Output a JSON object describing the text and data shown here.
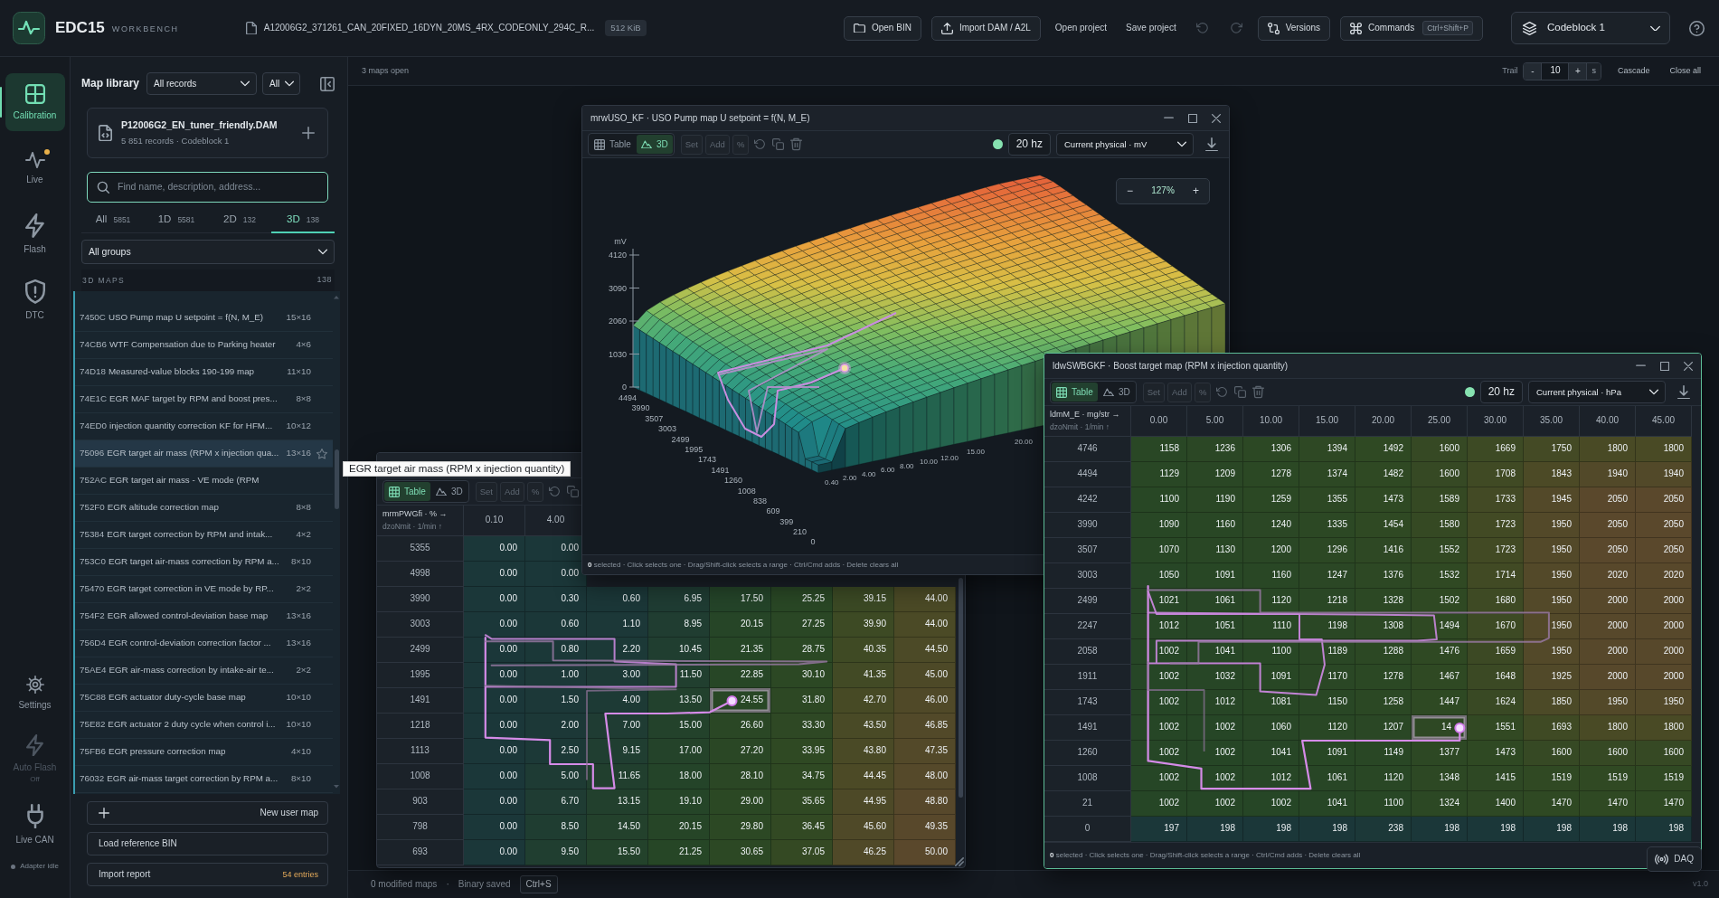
{
  "header": {
    "app_name": "EDC15",
    "tagline": "WORKBENCH",
    "file_name": "A12006G2_371261_CAN_20FIXED_16DYN_20MS_4RX_CODEONLY_294C_R...",
    "file_size": "512 KiB",
    "actions": [
      {
        "kind": "button",
        "label": "Open BIN"
      },
      {
        "kind": "button",
        "label": "Import DAM / A2L"
      },
      {
        "kind": "link",
        "label": "Open project"
      },
      {
        "kind": "link",
        "label": "Save project"
      },
      {
        "kind": "icon",
        "disabled": true
      },
      {
        "kind": "icon",
        "disabled": true
      },
      {
        "kind": "button",
        "label": "Versions"
      },
      {
        "kind": "button",
        "label": "Commands",
        "shortcut": "Ctrl+Shift+P"
      }
    ],
    "codeblock": "Codeblock 1"
  },
  "rail": {
    "items": [
      {
        "label": "Calibration",
        "selected": true,
        "alert": false
      },
      {
        "label": "Live",
        "selected": false,
        "alert": true
      },
      {
        "label": "Flash",
        "selected": false,
        "alert": false
      },
      {
        "label": "DTC",
        "selected": false,
        "alert": false
      }
    ],
    "tools": [
      {
        "label": "Settings",
        "disabled": false
      },
      {
        "label": "Auto Flash",
        "status": "Off",
        "disabled": true
      },
      {
        "label": "Live CAN",
        "disabled": false
      }
    ],
    "adapter": {
      "label": "Adapter idle",
      "connected": false
    }
  },
  "library": {
    "title": "Map library",
    "record_filter": "All records",
    "scope_filter": "All",
    "source": {
      "name": "P12006G2_EN_tuner_friendly.DAM",
      "info": "5 851 records · Codeblock 1"
    },
    "search": {
      "placeholder": "Find name, description, address...",
      "focused": true
    },
    "tabs": [
      {
        "label": "All",
        "count": "5851",
        "selected": false
      },
      {
        "label": "1D",
        "count": "5581",
        "selected": false
      },
      {
        "label": "2D",
        "count": "132",
        "selected": false
      },
      {
        "label": "3D",
        "count": "138",
        "selected": true
      }
    ],
    "group_filter": "All groups",
    "section": {
      "label": "3D MAPS",
      "count": "138"
    },
    "maps": [
      {
        "address": "7450C",
        "name": "USO Pump map U setpoint = f(N, M_E)",
        "size": "15×16",
        "hovered": false
      },
      {
        "address": "74CB6",
        "name": "WTF Compensation due to Parking heater",
        "size": "4×6",
        "hovered": false
      },
      {
        "address": "74D18",
        "name": "Measured-value blocks 190-199 map",
        "size": "11×10",
        "hovered": false
      },
      {
        "address": "74E1C",
        "name": "EGR MAF target by RPM and boost pres...",
        "size": "8×8",
        "hovered": false
      },
      {
        "address": "74ED0",
        "name": "injection quantity correction KF for HFM...",
        "size": "10×12",
        "hovered": false
      },
      {
        "address": "75096",
        "name": "EGR target air mass (RPM x injection qua...",
        "size": "13×16",
        "hovered": true
      },
      {
        "address": "752AC",
        "name": "EGR target air mass - VE mode (RPM",
        "hovered": false
      },
      {
        "address": "752F0",
        "name": "EGR altitude correction map",
        "size": "8×8",
        "hovered": false
      },
      {
        "address": "75384",
        "name": "EGR target correction by RPM and intak...",
        "size": "4×2",
        "hovered": false
      },
      {
        "address": "753C0",
        "name": "EGR target air-mass correction by RPM a...",
        "size": "8×10",
        "hovered": false
      },
      {
        "address": "75470",
        "name": "EGR target correction in VE mode by RP...",
        "size": "2×2",
        "hovered": false
      },
      {
        "address": "754F2",
        "name": "EGR allowed control-deviation base map",
        "size": "13×16",
        "hovered": false
      },
      {
        "address": "756D4",
        "name": "EGR control-deviation correction factor ...",
        "size": "13×16",
        "hovered": false
      },
      {
        "address": "75AE4",
        "name": "EGR air-mass correction by intake-air te...",
        "size": "2×2",
        "hovered": false
      },
      {
        "address": "75C88",
        "name": "EGR actuator duty-cycle base map",
        "size": "10×10",
        "hovered": false
      },
      {
        "address": "75E82",
        "name": "EGR actuator 2 duty cycle when control i...",
        "size": "10×10",
        "hovered": false
      },
      {
        "address": "75FB6",
        "name": "EGR pressure correction map",
        "size": "4×10",
        "hovered": false
      },
      {
        "address": "76032",
        "name": "EGR air-mass target correction by RPM a...",
        "size": "8×10",
        "hovered": false
      }
    ],
    "tooltip": "EGR target air mass (RPM x injection quantity)",
    "actions": [
      {
        "kind": "add",
        "label": "New user map"
      },
      {
        "kind": "plain",
        "label": "Load reference BIN"
      },
      {
        "kind": "plain",
        "label": "Import report",
        "note": "54 entries"
      }
    ]
  },
  "workspace": {
    "summary": "3 maps open",
    "trail": {
      "label": "Trail",
      "decrease": "-",
      "value": "10",
      "increase": "+",
      "unit": "s"
    },
    "actions": [
      "Cascade",
      "Close all"
    ],
    "windows": [
      {
        "kind": "table",
        "active": false,
        "view_tabs": [
          {
            "label": "Table",
            "selected": true
          },
          {
            "label": "3D",
            "selected": false
          }
        ],
        "edit": [
          {
            "label": "Set",
            "disabled": true
          },
          {
            "label": "Add",
            "disabled": true
          },
          {
            "label": "%",
            "disabled": true
          }
        ],
        "tools": [
          {
            "kind": "undo"
          },
          {
            "kind": "copy"
          }
        ],
        "table": {
          "x_axis": "mrmPWGfi · % →",
          "y_axis": "dzoNmit · 1/min ↑",
          "columns": [
            "0.10",
            "4.00"
          ],
          "rows": [
            {
              "label": "5355",
              "values": [
                "0.00",
                "0.00"
              ]
            },
            {
              "label": "4998",
              "values": [
                "0.00",
                "0.00"
              ]
            },
            {
              "label": "3990",
              "values": [
                "0.00",
                "0.30",
                "0.60",
                "6.95",
                "17.50",
                "25.25",
                "39.15",
                "44.00"
              ]
            },
            {
              "label": "3003",
              "values": [
                "0.00",
                "0.60",
                "1.10",
                "8.95",
                "20.15",
                "27.25",
                "39.90",
                "44.00"
              ]
            },
            {
              "label": "2499",
              "values": [
                "0.00",
                "0.80",
                "2.20",
                "10.45",
                "21.35",
                "28.75",
                "40.35",
                "44.50"
              ]
            },
            {
              "label": "1995",
              "values": [
                "0.00",
                "1.00",
                "3.00",
                "11.50",
                "22.85",
                "30.10",
                "41.35",
                "45.00"
              ]
            },
            {
              "label": "1491",
              "values": [
                "0.00",
                "1.50",
                "4.00",
                "13.50",
                {
                  "value": "24.55",
                  "live": true
                },
                "31.80",
                "42.70",
                "46.00"
              ]
            },
            {
              "label": "1218",
              "values": [
                "0.00",
                "2.00",
                "7.00",
                "15.00",
                "26.60",
                "33.30",
                "43.50",
                "46.85"
              ]
            },
            {
              "label": "1113",
              "values": [
                "0.00",
                "2.50",
                "9.15",
                "17.00",
                "27.20",
                "33.95",
                "43.80",
                "47.35"
              ]
            },
            {
              "label": "1008",
              "values": [
                "0.00",
                "5.00",
                "11.65",
                "18.00",
                "28.10",
                "34.75",
                "44.45",
                "48.00"
              ]
            },
            {
              "label": "903",
              "values": [
                "0.00",
                "6.70",
                "13.15",
                "19.10",
                "29.00",
                "35.65",
                "44.95",
                "48.80"
              ]
            },
            {
              "label": "798",
              "values": [
                "0.00",
                "8.50",
                "14.50",
                "20.15",
                "29.80",
                "36.45",
                "45.60",
                "49.35"
              ]
            },
            {
              "label": "693",
              "values": [
                "0.00",
                "9.50",
                "15.50",
                "21.25",
                "30.65",
                "37.05",
                "46.25",
                "50.00"
              ]
            }
          ]
        }
      },
      {
        "kind": "surface",
        "title": "mrwUSO_KF · USO Pump map U setpoint = f(N, M_E)",
        "active": false,
        "controls": true,
        "view_tabs": [
          {
            "label": "Table",
            "selected": false
          },
          {
            "label": "3D",
            "selected": true
          }
        ],
        "edit": [
          {
            "label": "Set",
            "disabled": true
          },
          {
            "label": "Add",
            "disabled": true
          },
          {
            "label": "%",
            "disabled": true
          }
        ],
        "tools": [
          {
            "kind": "undo"
          },
          {
            "kind": "copy"
          },
          {
            "kind": "delete"
          }
        ],
        "live": true,
        "rate": "20 hz",
        "source": "Current physical · mV",
        "plot": {
          "z_unit": "mV",
          "z_ticks": [
            "4120",
            "3090",
            "2060",
            "1030",
            "0"
          ],
          "rpm_ticks": [
            "4494",
            "3990",
            "3507",
            "3003",
            "2499",
            "1995",
            "1743",
            "1491",
            "1260",
            "1008",
            "838",
            "609",
            "399",
            "210",
            "0"
          ],
          "injection_ticks": [
            "0.40",
            "2.00",
            "4.00",
            "6.00",
            "8.00",
            "10.00",
            "12.00",
            "15.00",
            "20.00"
          ]
        },
        "zoom": {
          "decrease": "−",
          "level": "127%",
          "increase": "+"
        },
        "footer": "**0** selected · Click selects one · Drag/Shift-click selects a range · Ctrl/Cmd adds · Delete clears all"
      },
      {
        "kind": "table",
        "title": "ldwSWBGKF · Boost target map (RPM x injection quantity)",
        "active": true,
        "controls": true,
        "view_tabs": [
          {
            "label": "Table",
            "selected": true
          },
          {
            "label": "3D",
            "selected": false
          }
        ],
        "edit": [
          {
            "label": "Set",
            "disabled": true
          },
          {
            "label": "Add",
            "disabled": true
          },
          {
            "label": "%",
            "disabled": true
          }
        ],
        "tools": [
          {
            "kind": "undo"
          },
          {
            "kind": "copy"
          },
          {
            "kind": "delete"
          }
        ],
        "live": true,
        "rate": "20 hz",
        "source": "Current physical · hPa",
        "table": {
          "x_axis": "ldmM_E · mg/str →",
          "y_axis": "dzoNmit · 1/min ↑",
          "columns": [
            "0.00",
            "5.00",
            "10.00",
            "15.00",
            "20.00",
            "25.00",
            "30.00",
            "35.00",
            "40.00",
            "45.00"
          ],
          "rows": [
            {
              "label": "4746",
              "values": [
                "1158",
                "1236",
                "1306",
                "1394",
                "1492",
                "1600",
                "1669",
                "1750",
                "1800",
                "1800"
              ]
            },
            {
              "label": "4494",
              "values": [
                "1129",
                "1209",
                "1278",
                "1374",
                "1482",
                "1600",
                "1708",
                "1843",
                "1940",
                "1940"
              ]
            },
            {
              "label": "4242",
              "values": [
                "1100",
                "1190",
                "1259",
                "1355",
                "1473",
                "1589",
                "1733",
                "1945",
                "2050",
                "2050"
              ]
            },
            {
              "label": "3990",
              "values": [
                "1090",
                "1160",
                "1240",
                "1335",
                "1454",
                "1580",
                "1723",
                "1950",
                "2050",
                "2050"
              ]
            },
            {
              "label": "3507",
              "values": [
                "1070",
                "1130",
                "1200",
                "1296",
                "1416",
                "1552",
                "1723",
                "1950",
                "2050",
                "2050"
              ]
            },
            {
              "label": "3003",
              "values": [
                "1050",
                "1091",
                "1160",
                "1247",
                "1376",
                "1532",
                "1714",
                "1950",
                "2020",
                "2020"
              ]
            },
            {
              "label": "2499",
              "values": [
                "1021",
                "1061",
                "1120",
                "1218",
                "1328",
                "1502",
                "1680",
                "1950",
                "2000",
                "2000"
              ]
            },
            {
              "label": "2247",
              "values": [
                "1012",
                "1051",
                "1110",
                "1198",
                "1308",
                "1494",
                "1670",
                "1950",
                "2000",
                "2000"
              ]
            },
            {
              "label": "2058",
              "values": [
                "1002",
                "1041",
                "1100",
                "1189",
                "1288",
                "1476",
                "1659",
                "1950",
                "2000",
                "2000"
              ]
            },
            {
              "label": "1911",
              "values": [
                "1002",
                "1032",
                "1091",
                "1170",
                "1278",
                "1467",
                "1648",
                "1925",
                "2000",
                "2000"
              ]
            },
            {
              "label": "1743",
              "values": [
                "1002",
                "1012",
                "1081",
                "1150",
                "1258",
                "1447",
                "1624",
                "1850",
                "1950",
                "1950"
              ]
            },
            {
              "label": "1491",
              "values": [
                "1002",
                "1002",
                "1060",
                "1120",
                "1207",
                {
                  "value": "14",
                  "live": true
                },
                "1551",
                "1693",
                "1800",
                "1800"
              ]
            },
            {
              "label": "1260",
              "values": [
                "1002",
                "1002",
                "1041",
                "1091",
                "1149",
                "1377",
                "1473",
                "1600",
                "1600",
                "1600"
              ]
            },
            {
              "label": "1008",
              "values": [
                "1002",
                "1002",
                "1012",
                "1061",
                "1120",
                "1348",
                "1415",
                "1519",
                "1519",
                "1519"
              ]
            },
            {
              "label": "21",
              "values": [
                "1002",
                "1002",
                "1002",
                "1041",
                "1100",
                "1324",
                "1400",
                "1470",
                "1470",
                "1470"
              ]
            },
            {
              "label": "0",
              "values": [
                "197",
                "198",
                "198",
                "198",
                "238",
                "198",
                "198",
                "198",
                "198",
                "198"
              ]
            }
          ]
        },
        "footer": "**0** selected · Click selects one · Drag/Shift-click selects a range · Ctrl/Cmd adds · Delete clears all"
      }
    ],
    "status": {
      "modified": "0 modified maps",
      "separator": "·",
      "saved": "Binary saved",
      "shortcut": "Ctrl+S"
    },
    "daq": "DAQ",
    "version": "v1.0"
  }
}
